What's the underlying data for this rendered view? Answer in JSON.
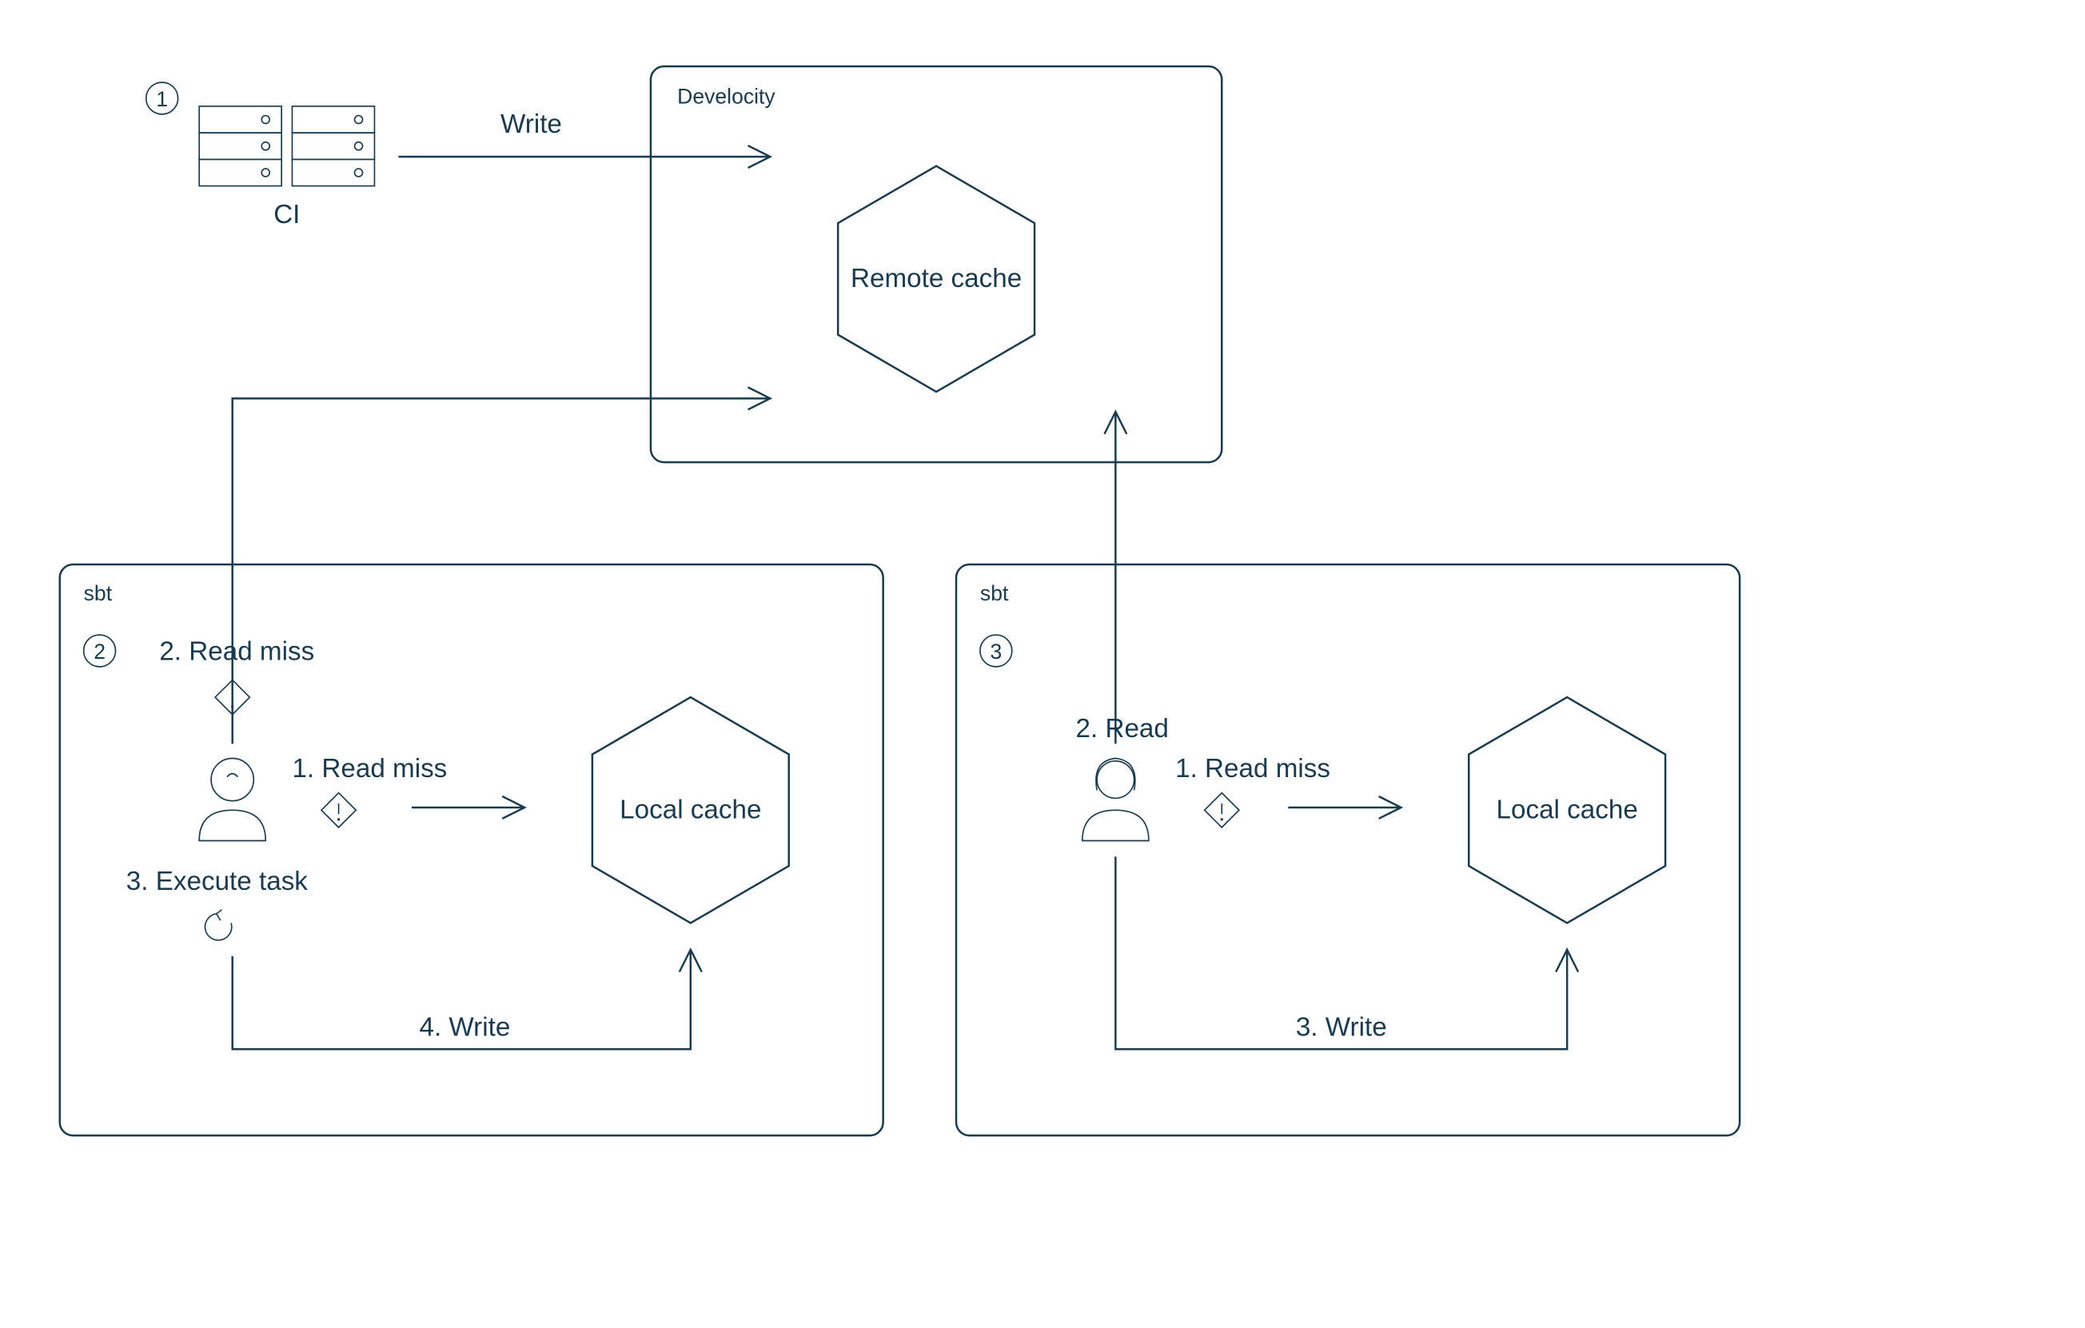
{
  "diagram": {
    "develocity": {
      "title": "Develocity",
      "remote_cache_label": "Remote cache"
    },
    "ci": {
      "label": "CI",
      "write_label": "Write"
    },
    "sbt_left": {
      "title": "sbt",
      "step_badge": "2",
      "step2_label": "2. Read miss",
      "step1_label": "1. Read miss",
      "step3_label": "3. Execute task",
      "step4_label": "4. Write",
      "local_cache_label": "Local cache"
    },
    "sbt_right": {
      "title": "sbt",
      "step_badge": "3",
      "step2_label": "2. Read",
      "step1_label": "1. Read miss",
      "step3_label": "3. Write",
      "local_cache_label": "Local cache"
    },
    "badges": {
      "one": "1"
    }
  }
}
